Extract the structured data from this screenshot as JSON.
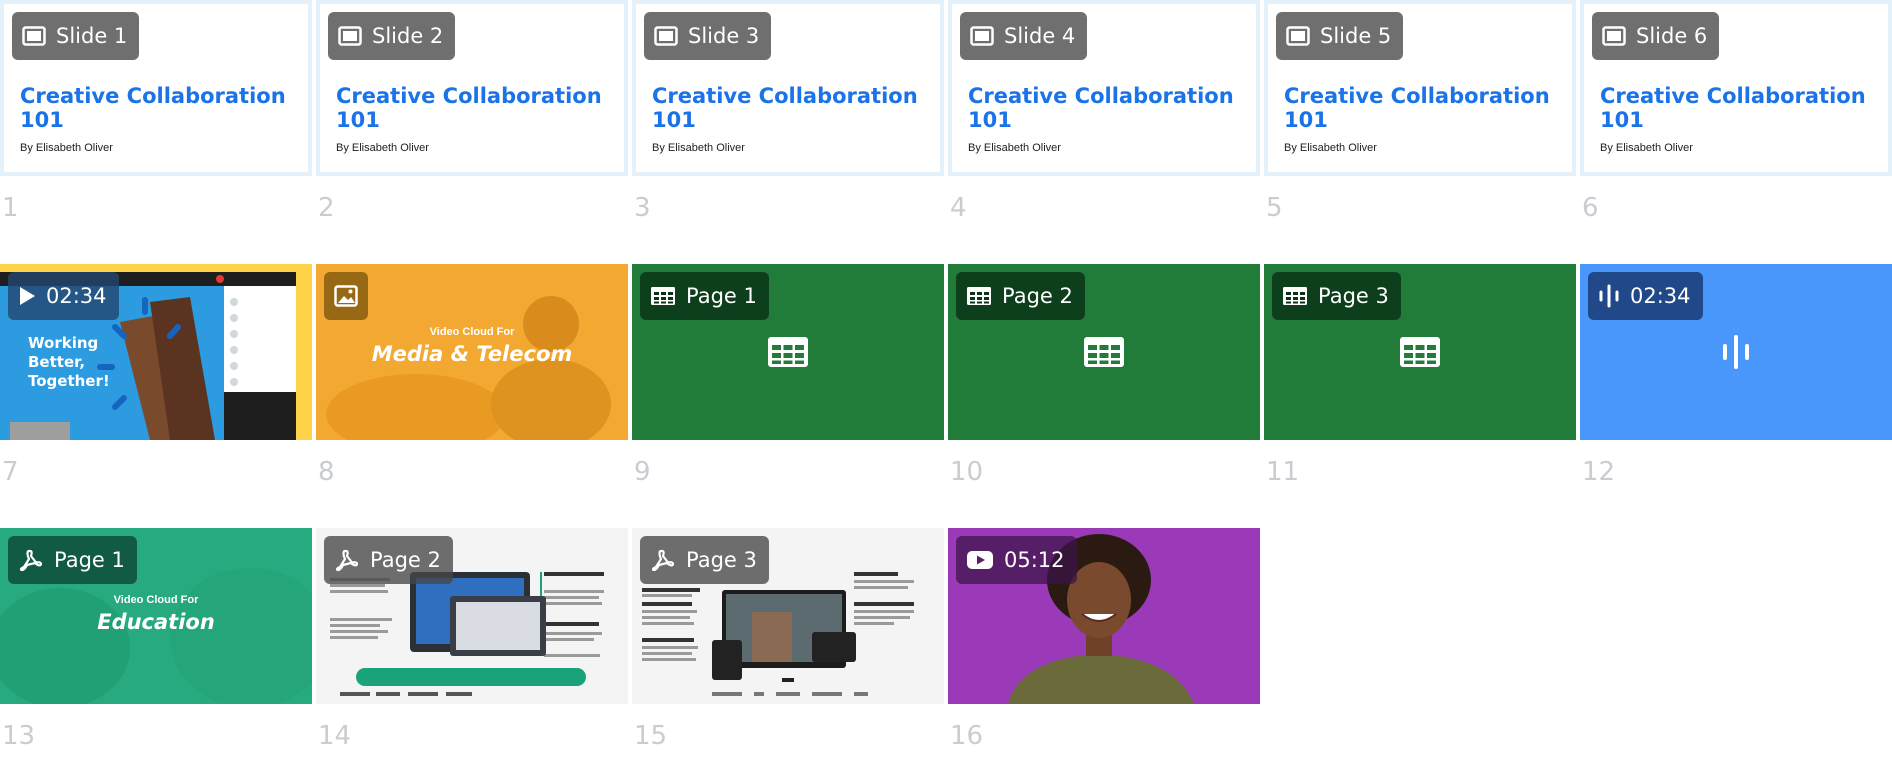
{
  "slides": [
    {
      "badge": "Slide 1",
      "title": "Creative Collaboration 101",
      "byline": "By Elisabeth Oliver",
      "number": "1"
    },
    {
      "badge": "Slide 2",
      "title": "Creative Collaboration 101",
      "byline": "By Elisabeth Oliver",
      "number": "2"
    },
    {
      "badge": "Slide 3",
      "title": "Creative Collaboration 101",
      "byline": "By Elisabeth Oliver",
      "number": "3"
    },
    {
      "badge": "Slide 4",
      "title": "Creative Collaboration 101",
      "byline": "By Elisabeth Oliver",
      "number": "4"
    },
    {
      "badge": "Slide 5",
      "title": "Creative Collaboration 101",
      "byline": "By Elisabeth Oliver",
      "number": "5"
    },
    {
      "badge": "Slide 6",
      "title": "Creative Collaboration 101",
      "byline": "By Elisabeth Oliver",
      "number": "6"
    }
  ],
  "row2": [
    {
      "type": "video",
      "badge": "02:34",
      "caption": "Working Better, Together!",
      "number": "7"
    },
    {
      "type": "image",
      "badge": "",
      "line1": "Video Cloud For",
      "line2": "Media & Telecom",
      "number": "8"
    },
    {
      "type": "spreadsheet",
      "badge": "Page 1",
      "number": "9"
    },
    {
      "type": "spreadsheet",
      "badge": "Page 2",
      "number": "10"
    },
    {
      "type": "spreadsheet",
      "badge": "Page 3",
      "number": "11"
    },
    {
      "type": "audio",
      "badge": "02:34",
      "number": "12"
    }
  ],
  "row3": [
    {
      "type": "pdf",
      "badge": "Page 1",
      "line1": "Video Cloud For",
      "line2": "Education",
      "number": "13"
    },
    {
      "type": "pdf",
      "badge": "Page 2",
      "number": "14"
    },
    {
      "type": "pdf",
      "badge": "Page 3",
      "number": "15"
    },
    {
      "type": "youtube",
      "badge": "05:12",
      "number": "16"
    }
  ],
  "colors": {
    "slide_title": "#1a73e8",
    "sheet_green": "#207c38",
    "audio_blue": "#4a97fb",
    "number_grey": "#c9cdd1"
  }
}
